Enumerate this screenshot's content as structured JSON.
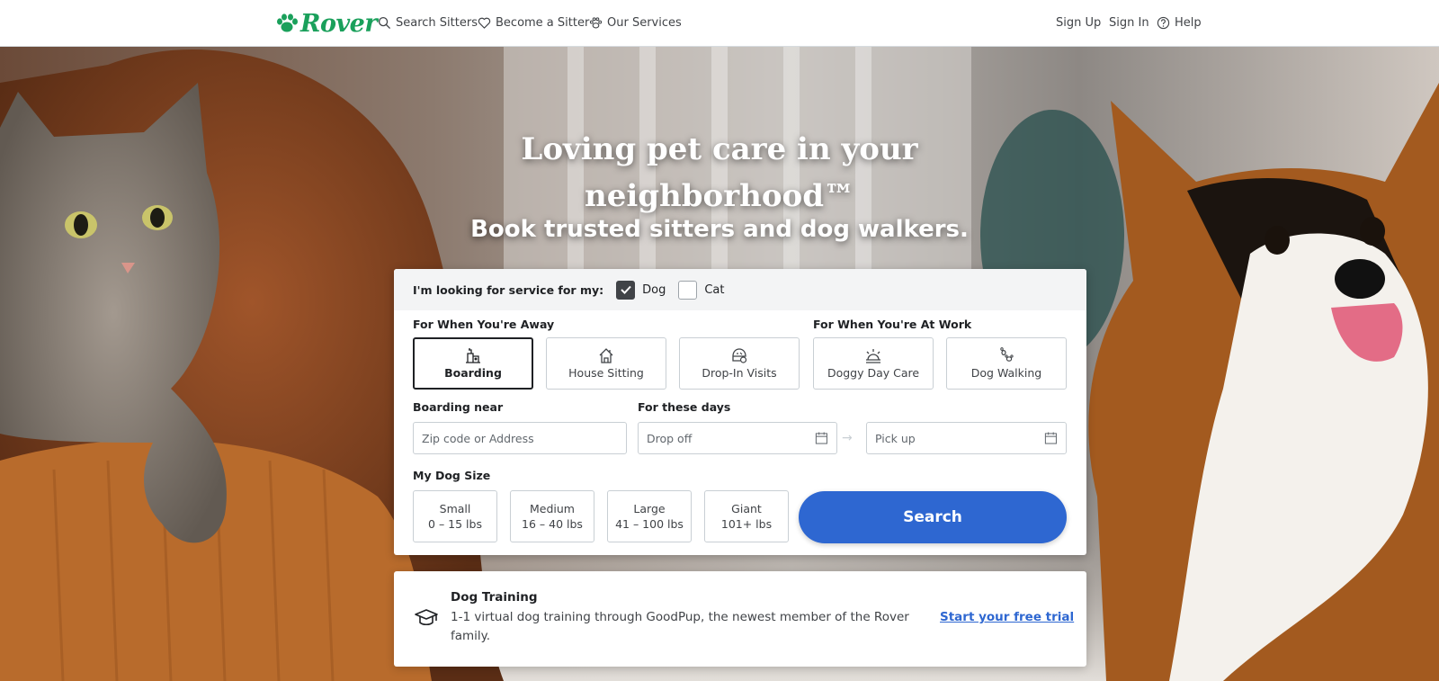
{
  "header": {
    "brand": "Rover",
    "nav_left": [
      {
        "label": "Search Sitters",
        "icon": "search-icon"
      },
      {
        "label": "Become a Sitter",
        "icon": "heart-icon"
      },
      {
        "label": "Our Services",
        "icon": "paw-icon"
      }
    ],
    "nav_right": [
      {
        "label": "Sign Up"
      },
      {
        "label": "Sign In"
      },
      {
        "label": "Help",
        "icon": "help-icon"
      }
    ]
  },
  "hero": {
    "title_line1": "Loving pet care in your",
    "title_line2": "neighborhood™",
    "subtitle": "Book trusted sitters and dog walkers."
  },
  "search": {
    "pet_prompt": "I'm looking for service for my:",
    "pets": [
      {
        "label": "Dog",
        "checked": true
      },
      {
        "label": "Cat",
        "checked": false
      }
    ],
    "away_label": "For When You're Away",
    "work_label": "For When You're At Work",
    "services": [
      {
        "label": "Boarding",
        "icon": "boarding-icon",
        "selected": true
      },
      {
        "label": "House Sitting",
        "icon": "house-sitting-icon",
        "selected": false
      },
      {
        "label": "Drop-In Visits",
        "icon": "drop-in-icon",
        "selected": false
      },
      {
        "label": "Doggy Day Care",
        "icon": "day-care-icon",
        "selected": false
      },
      {
        "label": "Dog Walking",
        "icon": "dog-walking-icon",
        "selected": false
      }
    ],
    "location_label": "Boarding near",
    "location_placeholder": "Zip code or Address",
    "dates_label": "For these days",
    "dropoff_placeholder": "Drop off",
    "pickup_placeholder": "Pick up",
    "size_label": "My Dog Size",
    "sizes": [
      {
        "name": "Small",
        "range": "0 – 15 lbs"
      },
      {
        "name": "Medium",
        "range": "16 – 40 lbs"
      },
      {
        "name": "Large",
        "range": "41 – 100 lbs"
      },
      {
        "name": "Giant",
        "range": "101+ lbs"
      }
    ],
    "search_button": "Search"
  },
  "promo": {
    "title": "Dog Training",
    "description": "1-1 virtual dog training through GoodPup, the newest member of the Rover family.",
    "link": "Start your free trial",
    "icon": "graduation-cap-icon"
  },
  "colors": {
    "brand_green": "#1aa05b",
    "primary_blue": "#2e67d1",
    "text_dark": "#1f2124"
  }
}
